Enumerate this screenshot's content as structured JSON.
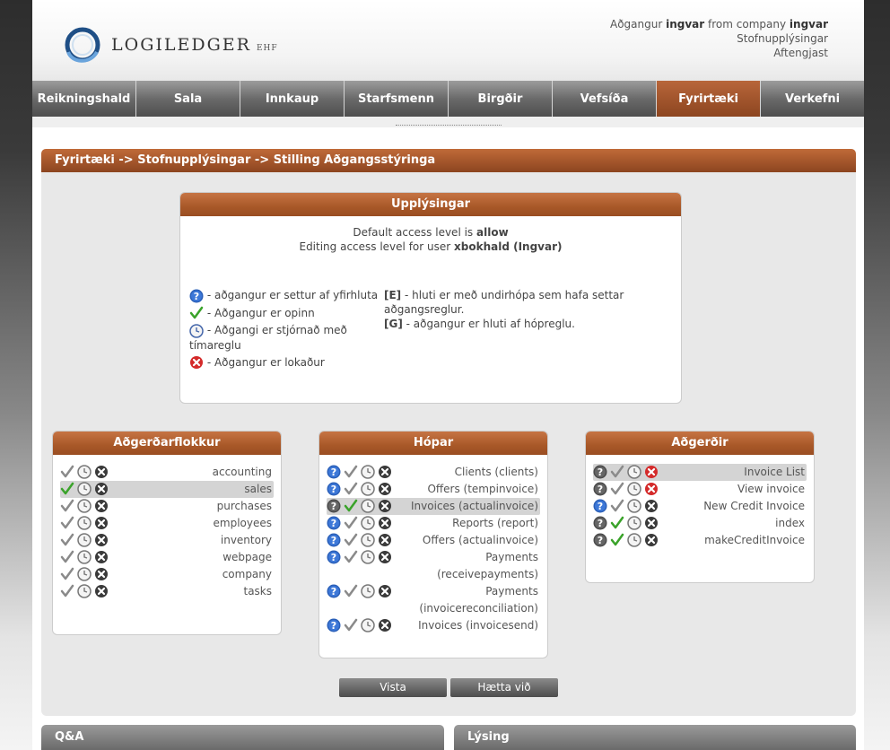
{
  "brand": {
    "name": "LOGILEDGER",
    "suffix": "EHF"
  },
  "user": {
    "prefix": "Aðgangur",
    "username": "ingvar",
    "from": "from company",
    "company": "ingvar",
    "link1": "Stofnupplýsingar",
    "link2": "Aftengjast"
  },
  "nav": [
    "Reikningshald",
    "Sala",
    "Innkaup",
    "Starfsmenn",
    "Birgðir",
    "Vefsíða",
    "Fyrirtæki",
    "Verkefni"
  ],
  "breadcrumb": "Fyrirtæki -> Stofnupplýsingar -> Stilling Aðgangsstýringa",
  "info": {
    "title": "Upplýsingar",
    "line1_pre": "Default access level is",
    "line1_val": "allow",
    "line2_pre": "Editing access level for user",
    "line2_val": "xbokhald (Ingvar)",
    "legend_left": [
      "- aðgangur er settur af yfirhluta",
      "- Aðgangur er opinn",
      "- Aðgangi er stjórnað með tímareglu",
      "- Aðgangur er lokaður"
    ],
    "legend_right": [
      {
        "tag": "[E]",
        "text": "- hluti er með undirhópa sem hafa settar aðgangsreglur."
      },
      {
        "tag": "[G]",
        "text": "- aðgangur er hluti af hópreglu."
      }
    ]
  },
  "categories": {
    "title": "Aðgerðarflokkur",
    "items": [
      "accounting",
      "sales",
      "purchases",
      "employees",
      "inventory",
      "webpage",
      "company",
      "tasks"
    ]
  },
  "groups": {
    "title": "Hópar",
    "items": [
      "Clients (clients)",
      "Offers (tempinvoice)",
      "Invoices (actualinvoice)",
      "Reports (report)",
      "Offers (actualinvoice)",
      "Payments (receivepayments)",
      "Payments (invoicereconciliation)",
      "Invoices (invoicesend)"
    ]
  },
  "actions": {
    "title": "Aðgerðir",
    "items": [
      "Invoice List",
      "View invoice",
      "New Credit Invoice",
      "index",
      "makeCreditInvoice"
    ]
  },
  "buttons": {
    "save": "Vista",
    "cancel": "Hætta við"
  },
  "footer": {
    "left": "Q&A",
    "right": "Lýsing"
  }
}
